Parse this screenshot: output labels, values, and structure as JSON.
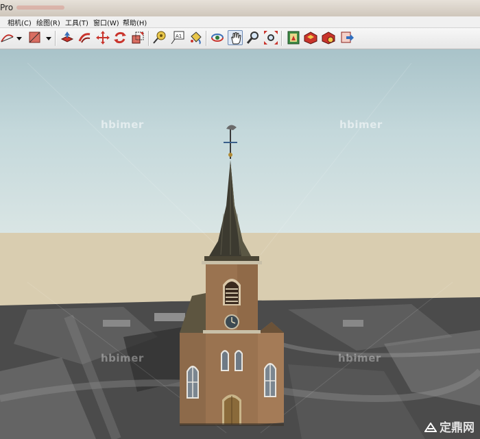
{
  "window": {
    "title_fragment": "Pro"
  },
  "menu": {
    "items": [
      {
        "label": "相机(C)"
      },
      {
        "label": "绘图(R)"
      },
      {
        "label": "工具(T)"
      },
      {
        "label": "窗口(W)"
      },
      {
        "label": "帮助(H)"
      }
    ]
  },
  "toolbar": {
    "tools": [
      {
        "icon": "arc-icon"
      },
      {
        "icon": "shape-icon"
      },
      {
        "icon": "push-pull-icon"
      },
      {
        "icon": "follow-me-icon"
      },
      {
        "icon": "move-icon"
      },
      {
        "icon": "rotate-icon"
      },
      {
        "icon": "scale-icon"
      },
      {
        "icon": "tape-measure-icon"
      },
      {
        "icon": "text-icon"
      },
      {
        "icon": "paint-bucket-icon"
      },
      {
        "icon": "orbit-icon"
      },
      {
        "icon": "pan-icon",
        "active": true
      },
      {
        "icon": "zoom-icon"
      },
      {
        "icon": "zoom-extents-icon"
      },
      {
        "icon": "component-browser-icon"
      },
      {
        "icon": "3d-warehouse-icon"
      },
      {
        "icon": "get-models-icon"
      },
      {
        "icon": "share-model-icon"
      }
    ],
    "text_tool_glyph": "A1"
  },
  "watermarks": {
    "text": "hbimer"
  },
  "site_mark": {
    "text": "定鼎网"
  },
  "colors": {
    "sky_top": "#a9c3c9",
    "sky_bottom": "#d9e5e4",
    "ground": "#d9cdb0",
    "terrain": "#4a4a4a",
    "brick": "#9a7350",
    "spire": "#3c3a30"
  }
}
